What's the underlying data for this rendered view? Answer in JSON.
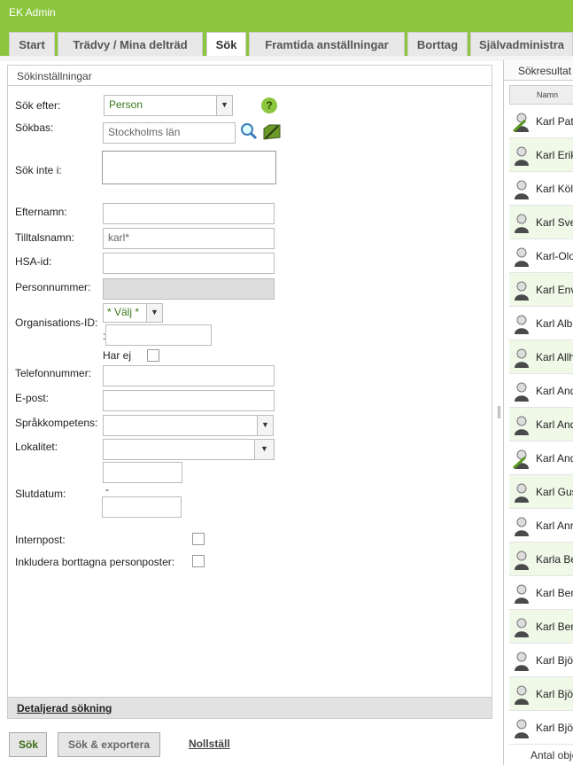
{
  "app": {
    "title": "EK Admin"
  },
  "tabs": [
    {
      "label": "Start"
    },
    {
      "label": "Trädvy / Mina delträd"
    },
    {
      "label": "Sök"
    },
    {
      "label": "Framtida anställningar"
    },
    {
      "label": "Borttag"
    },
    {
      "label": "Självadministra"
    }
  ],
  "search_panel": {
    "title": "Sökinställningar",
    "sok_efter_label": "Sök efter:",
    "sok_efter_value": "Person",
    "sokbas_label": "Sökbas:",
    "sokbas_value": "Stockholms län",
    "sok_inte_label": "Sök inte i:",
    "efternamn_label": "Efternamn:",
    "tilltalsnamn_label": "Tilltalsnamn:",
    "tilltalsnamn_value": "karl*",
    "hsaid_label": "HSA-id:",
    "personnummer_label": "Personnummer:",
    "orgid_label": "Organisations-ID:",
    "orgid_select": "* Välj *",
    "orgid_colon": ":",
    "har_ej_label": "Har ej",
    "telefon_label": "Telefonnummer:",
    "epost_label": "E-post:",
    "sprak_label": "Språkkompetens:",
    "lokalitet_label": "Lokalitet:",
    "slutdatum_label": "Slutdatum:",
    "slutdatum_dash": "-",
    "internpost_label": "Internpost:",
    "inkludera_label": "Inkludera borttagna personposter:",
    "detail_link": "Detaljerad sökning",
    "help_glyph": "?"
  },
  "buttons": {
    "sok": "Sök",
    "sok_exportera": "Sök & exportera",
    "nollstall": "Nollställ"
  },
  "results": {
    "title": "Sökresultat",
    "column_name": "Namn",
    "rows": [
      {
        "name": "Karl Pat",
        "icon": "person-edit-icon"
      },
      {
        "name": "Karl Erik",
        "icon": "person-icon"
      },
      {
        "name": "Karl Köl",
        "icon": "person-icon"
      },
      {
        "name": "Karl Sve",
        "icon": "person-icon"
      },
      {
        "name": "Karl-Olo",
        "icon": "person-icon"
      },
      {
        "name": "Karl Env",
        "icon": "person-icon"
      },
      {
        "name": "Karl Alb",
        "icon": "person-icon"
      },
      {
        "name": "Karl Allh",
        "icon": "person-icon"
      },
      {
        "name": "Karl And",
        "icon": "person-icon"
      },
      {
        "name": "Karl And",
        "icon": "person-icon"
      },
      {
        "name": "Karl And",
        "icon": "person-edit-icon"
      },
      {
        "name": "Karl Gus",
        "icon": "person-icon"
      },
      {
        "name": "Karl Anr",
        "icon": "person-icon"
      },
      {
        "name": "Karla Be",
        "icon": "person-icon"
      },
      {
        "name": "Karl Ben",
        "icon": "person-icon"
      },
      {
        "name": "Karl Ben",
        "icon": "person-icon"
      },
      {
        "name": "Karl Bjö",
        "icon": "person-icon"
      },
      {
        "name": "Karl Bjö",
        "icon": "person-icon"
      },
      {
        "name": "Karl Bjö",
        "icon": "person-icon"
      }
    ],
    "footer": "Antal obje"
  },
  "colors": {
    "brand": "#8cc63f",
    "row_alt": "#f0f8e8"
  }
}
